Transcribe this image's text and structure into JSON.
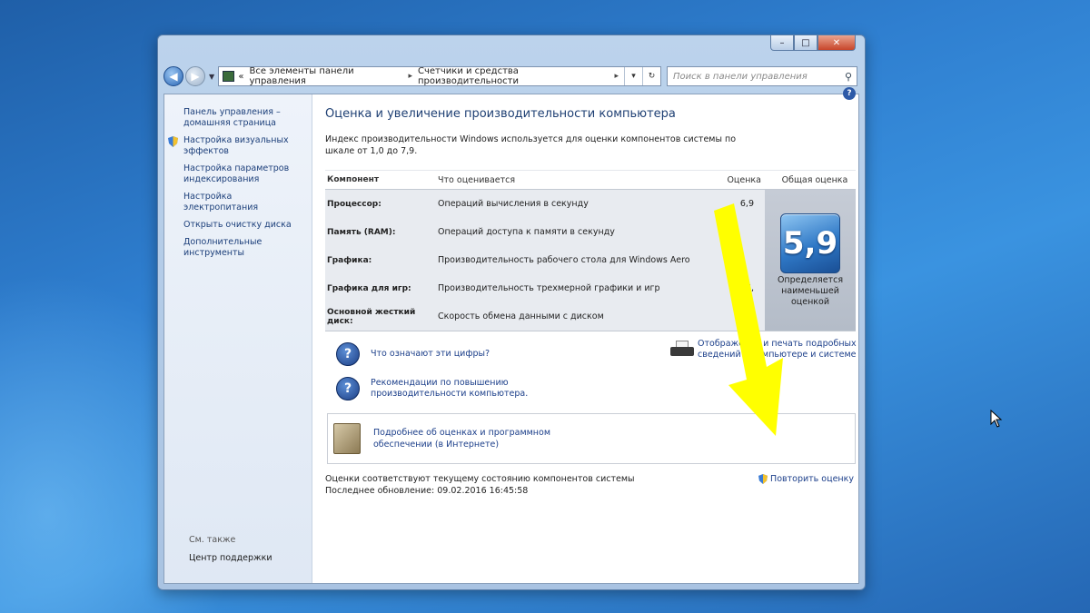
{
  "window": {
    "caption": {
      "minimize": "–",
      "maximize": "□",
      "close": "✕"
    }
  },
  "navbar": {
    "breadcrumb": [
      "Все элементы панели управления",
      "Счетчики и средства производительности"
    ],
    "breadcrumb_prefix": "«",
    "search_placeholder": "Поиск в панели управления"
  },
  "sidebar": {
    "items": [
      {
        "label": "Панель управления – домашняя страница",
        "shield": false
      },
      {
        "label": "Настройка визуальных эффектов",
        "shield": true
      },
      {
        "label": "Настройка параметров индексирования",
        "shield": false
      },
      {
        "label": "Настройка электропитания",
        "shield": false
      },
      {
        "label": "Открыть очистку диска",
        "shield": false
      },
      {
        "label": "Дополнительные инструменты",
        "shield": false
      }
    ],
    "see_also": "См. также",
    "support": "Центр поддержки"
  },
  "main": {
    "title": "Оценка и увеличение производительности компьютера",
    "intro": "Индекс производительности Windows используется для оценки компонентов системы по шкале от 1,0 до 7,9.",
    "table": {
      "headers": {
        "component": "Компонент",
        "what": "Что оценивается",
        "score": "Оценка",
        "total": "Общая оценка"
      },
      "rows": [
        {
          "component": "Процессор:",
          "what": "Операций вычисления в секунду",
          "score": "6,9"
        },
        {
          "component": "Память (RAM):",
          "what": "Операций доступа к памяти в секунду",
          "score": ""
        },
        {
          "component": "Графика:",
          "what": "Производительность рабочего стола для Windows Aero",
          "score": ""
        },
        {
          "component": "Графика для игр:",
          "what": "Производительность трехмерной графики и игр",
          "score": "7,"
        },
        {
          "component": "Основной жесткий диск:",
          "what": "Скорость обмена данными с диском",
          "score": "5,9"
        }
      ],
      "base_score": "5,9",
      "base_caption": "Определяется наименьшей оценкой"
    },
    "links": {
      "what_numbers": "Что означают эти цифры?",
      "recommendations": "Рекомендации по повышению производительности компьютера.",
      "print": "Отображение и печать подробных сведений о компьютере и системе",
      "online": "Подробнее об оценках и программном обеспечении (в Интернете)"
    },
    "footer": {
      "status": "Оценки соответствуют текущему состоянию компонентов системы",
      "last_update": "Последнее обновление: 09.02.2016 16:45:58",
      "rerun": "Повторить оценку"
    }
  },
  "colors": {
    "accent_link": "#1c3f8a",
    "arrow": "#ffff00",
    "badge": "#2f78c6"
  }
}
